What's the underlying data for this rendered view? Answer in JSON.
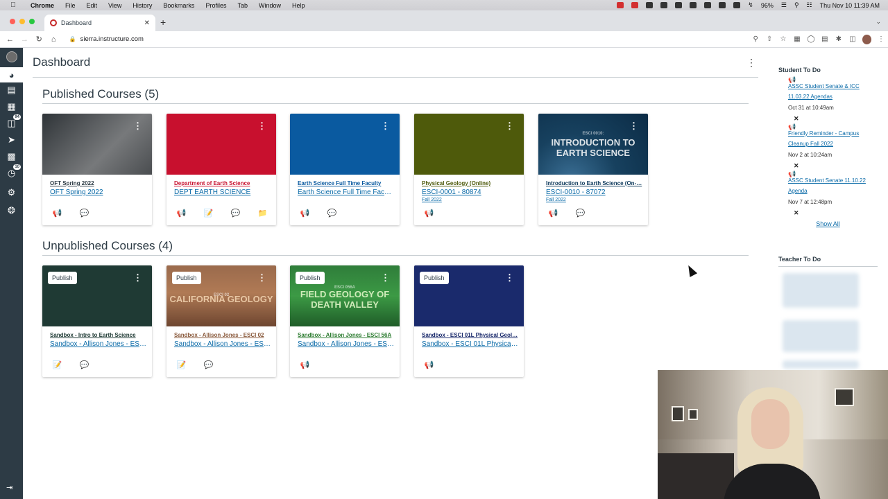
{
  "menubar": {
    "app": "Chrome",
    "items": [
      "File",
      "Edit",
      "View",
      "History",
      "Bookmarks",
      "Profiles",
      "Tab",
      "Window",
      "Help"
    ],
    "battery": "96%",
    "clock": "Thu Nov 10  11:39 AM"
  },
  "browser": {
    "tab_title": "Dashboard",
    "url": "sierra.instructure.com"
  },
  "global_nav": {
    "inbox_badge": "94",
    "history_badge": "10"
  },
  "page": {
    "title": "Dashboard"
  },
  "published": {
    "heading": "Published Courses (5)",
    "courses": [
      {
        "name": "OFT Spring 2022",
        "code": "OFT Spring 2022",
        "term": "",
        "color": "#5a5f63",
        "name_color": "#2d3b45",
        "hero_text": ""
      },
      {
        "name": "Department of Earth Science",
        "code": "DEPT EARTH SCIENCE",
        "term": "",
        "color": "#c8102e",
        "name_color": "#c8102e",
        "hero_text": ""
      },
      {
        "name": "Earth Science Full Time Faculty",
        "code": "Earth Science Full Time Faculty",
        "term": "",
        "color": "#0a5aa0",
        "name_color": "#0a5aa0",
        "hero_text": ""
      },
      {
        "name": "Physical Geology (Online)",
        "code": "ESCI-0001 - 80874",
        "term": "Fall 2022",
        "color": "#4e5a0b",
        "name_color": "#4e5a0b",
        "hero_text": ""
      },
      {
        "name": "Introduction to Earth Science (On-…",
        "code": "ESCI-0010 - 87072",
        "term": "Fall 2022",
        "color": "#0e3a5c",
        "name_color": "#0e3a5c",
        "hero_text": "INTRODUCTION TO EARTH SCIENCE",
        "hero_small": "ESCI 0010:"
      }
    ]
  },
  "unpublished": {
    "heading": "Unpublished Courses (4)",
    "publish_label": "Publish",
    "courses": [
      {
        "name": "Sandbox - Intro to Earth Science",
        "code": "Sandbox - Allison Jones - ESCI…",
        "color": "#1f3a34",
        "name_color": "#1f3a34",
        "hero_text": ""
      },
      {
        "name": "Sandbox - Allison Jones - ESCI 02",
        "code": "Sandbox - Allison Jones - ESCI…",
        "color": "#8a5a3c",
        "name_color": "#8a5a3c",
        "hero_text": "CALIFORNIA GEOLOGY",
        "hero_small": "ESCI 02"
      },
      {
        "name": "Sandbox - Allison Jones - ESCI 56A",
        "code": "Sandbox - Allison Jones - ESCI…",
        "color": "#2e7d32",
        "name_color": "#2e7d32",
        "hero_text": "FIELD GEOLOGY OF DEATH VALLEY",
        "hero_small": "ESCI 056A"
      },
      {
        "name": "Sandbox - ESCI 01L Physical Geol…",
        "code": "Sandbox - ESCI 01L Physical G…",
        "color": "#1a2a6c",
        "name_color": "#1a2a6c",
        "hero_text": ""
      }
    ]
  },
  "todo": {
    "heading": "Student To Do",
    "items": [
      {
        "title": "ASSC Student Senate & ICC 11.03.22 Agendas",
        "date": "Oct 31 at 10:49am"
      },
      {
        "title": "Friendly Reminder - Campus Cleanup Fall 2022",
        "date": "Nov 2 at 10:24am"
      },
      {
        "title": "ASSC Student Senate 11.10.22 Agenda",
        "date": "Nov 7 at 12:48pm"
      }
    ],
    "show_all": "Show All",
    "teacher_heading": "Teacher To Do"
  }
}
